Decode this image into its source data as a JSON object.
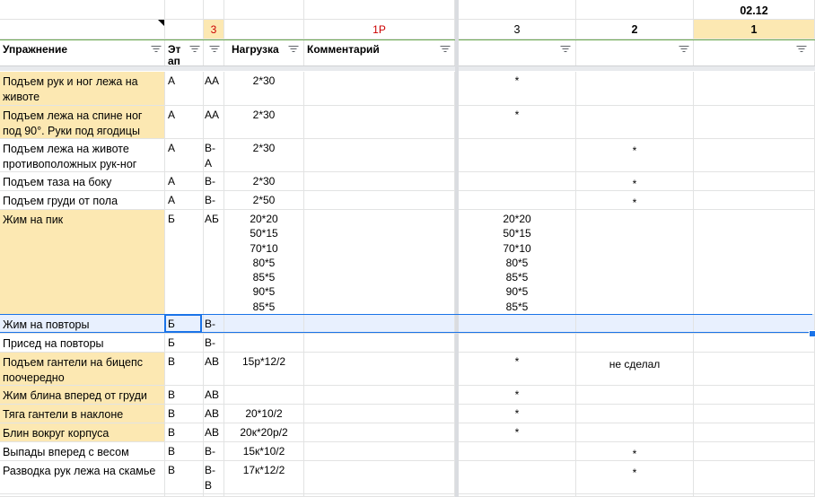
{
  "top_header": {
    "date_label": "02.12",
    "col_e_num": "3",
    "col_e_color": "#cc0000",
    "col_g_label": "1Р",
    "col_g_color": "#cc0000",
    "day_numbers": [
      "3",
      "2",
      "1"
    ]
  },
  "columns": {
    "exercise": "Упражнение",
    "stage": "Эт ап",
    "load": "Нагрузка",
    "comment": "Комментарий"
  },
  "colors": {
    "highlight": "#fce8b2",
    "selection": "#e8f0fe",
    "accent": "#1a73e8",
    "header_green": "#6aa84f"
  },
  "rows": [
    {
      "exercise": "Подъем рук и ног лежа на животе",
      "stage": "А",
      "level": "АА",
      "load": [
        "2*30"
      ],
      "d3": [
        "*"
      ],
      "d2": [],
      "d1": [],
      "highlight": true
    },
    {
      "exercise": "Подъем лежа на спине ног под 90°. Руки под ягодицы",
      "stage": "А",
      "level": "АА",
      "load": [
        "2*30"
      ],
      "d3": [
        "*"
      ],
      "d2": [],
      "d1": [],
      "highlight": true
    },
    {
      "exercise": "Подъем лежа на животе противоположных рук-ног",
      "stage": "А",
      "level": "В-А",
      "load": [
        "2*30"
      ],
      "d3": [],
      "d2": [
        "*"
      ],
      "d1": [],
      "highlight": false
    },
    {
      "exercise": "Подъем таза на боку",
      "stage": "А",
      "level": "В-А",
      "load": [
        "2*30"
      ],
      "d3": [],
      "d2": [
        "*"
      ],
      "d1": [],
      "highlight": false
    },
    {
      "exercise": "Подъем груди от пола",
      "stage": "А",
      "level": "В-А",
      "load": [
        "2*50"
      ],
      "d3": [],
      "d2": [
        "*"
      ],
      "d1": [],
      "highlight": false
    },
    {
      "exercise": "Жим на пик",
      "stage": "Б",
      "level": "АБ",
      "load": [
        "20*20",
        "50*15",
        "70*10",
        "80*5",
        "85*5",
        "90*5",
        "85*5"
      ],
      "d3": [
        "20*20",
        "50*15",
        "70*10",
        "80*5",
        "85*5",
        "90*5",
        "85*5"
      ],
      "d2": [],
      "d1": [],
      "highlight": true
    },
    {
      "exercise": "Жим на повторы",
      "stage": "Б",
      "level": "В-Б",
      "load": [],
      "d3": [],
      "d2": [],
      "d1": [],
      "highlight": false,
      "selected": true
    },
    {
      "exercise": "Присед на повторы",
      "stage": "Б",
      "level": "В-Б",
      "load": [],
      "d3": [],
      "d2": [],
      "d1": [],
      "highlight": false
    },
    {
      "exercise": "Подъем гантели на бицепс поочередно",
      "stage": "В",
      "level": "АВ",
      "load": [
        "15р*12/2"
      ],
      "d3": [
        "*"
      ],
      "d2": [
        "не сделал"
      ],
      "d1": [],
      "highlight": true
    },
    {
      "exercise": "Жим блина вперед от груди",
      "stage": "В",
      "level": "АВ",
      "load": [],
      "d3": [
        "*"
      ],
      "d2": [],
      "d1": [],
      "highlight": true
    },
    {
      "exercise": "Тяга гантели в наклоне",
      "stage": "В",
      "level": "АВ",
      "load": [
        "20*10/2"
      ],
      "d3": [
        "*"
      ],
      "d2": [],
      "d1": [],
      "highlight": true
    },
    {
      "exercise": "Блин вокруг корпуса",
      "stage": "В",
      "level": "АВ",
      "load": [
        "20к*20р/2"
      ],
      "d3": [
        "*"
      ],
      "d2": [],
      "d1": [],
      "highlight": true
    },
    {
      "exercise": "Выпады вперед с весом",
      "stage": "В",
      "level": "В-В",
      "load": [
        "15к*10/2"
      ],
      "d3": [],
      "d2": [
        "*"
      ],
      "d1": [],
      "highlight": false
    },
    {
      "exercise": "Разводка рук лежа на скамье",
      "stage": "В",
      "level": "В-В",
      "load": [
        "17к*12/2"
      ],
      "d3": [],
      "d2": [
        "*"
      ],
      "d1": [],
      "highlight": false
    }
  ]
}
